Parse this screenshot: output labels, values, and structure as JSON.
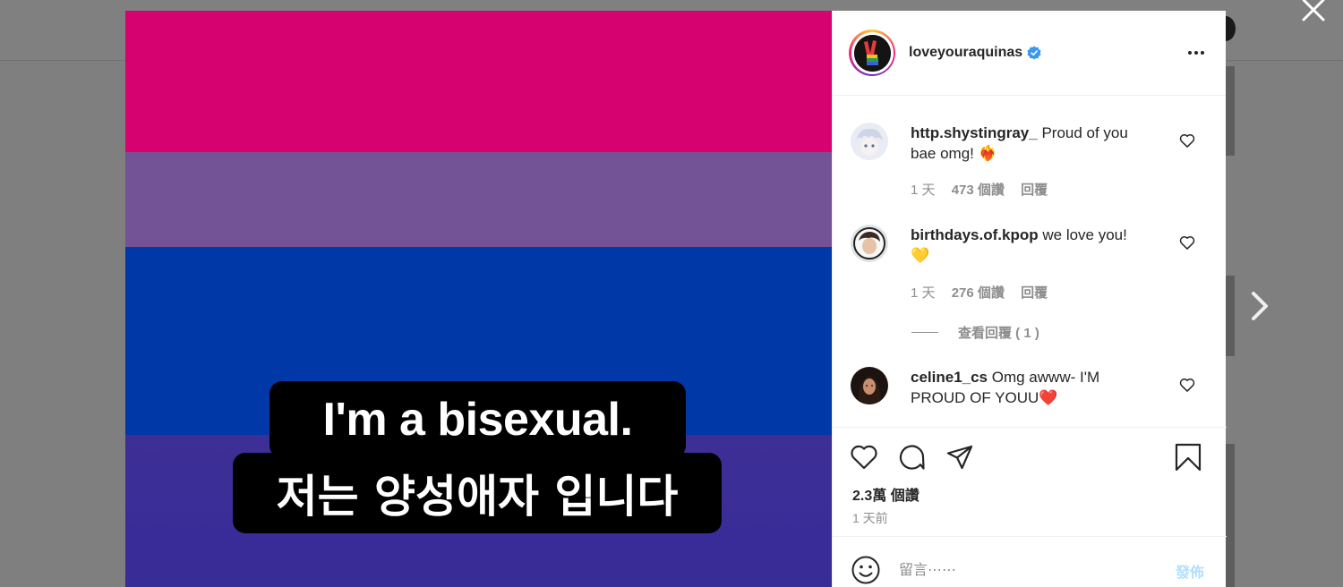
{
  "colors": {
    "flag_pink": "#d60270",
    "flag_purple": "#745296",
    "flag_blue": "#0038a8",
    "verified_blue": "#3897f0",
    "post_button_disabled": "#b2dffc"
  },
  "post": {
    "caption_en": "I'm a bisexual.",
    "caption_ko": "저는 양성애자 입니다"
  },
  "owner": {
    "username": "loveyouraquinas",
    "verified": true
  },
  "comments": [
    {
      "username": "http.shystingray_",
      "text": "Proud of you bae omg! ❤️‍🔥",
      "time": "1 天",
      "likes": "473 個讚",
      "reply_label": "回覆"
    },
    {
      "username": "birthdays.of.kpop",
      "text": "we love you! 💛",
      "time": "1 天",
      "likes": "276 個讚",
      "reply_label": "回覆",
      "view_replies": "查看回覆 ( 1 )"
    },
    {
      "username": "celine1_cs",
      "text": "Omg awww- I'M PROUD OF YOUU❤️"
    }
  ],
  "stats": {
    "likes": "2.3萬 個讚",
    "posted": "1 天前"
  },
  "composer": {
    "placeholder": "留言⋯⋯",
    "post_label": "發佈"
  },
  "icons": {
    "close": "close-icon",
    "next": "chevron-right-icon",
    "more": "more-horizontal-icon",
    "like": "heart-icon",
    "comment": "comment-bubble-icon",
    "share": "paper-plane-icon",
    "save": "bookmark-icon",
    "emoji": "smiley-icon"
  }
}
